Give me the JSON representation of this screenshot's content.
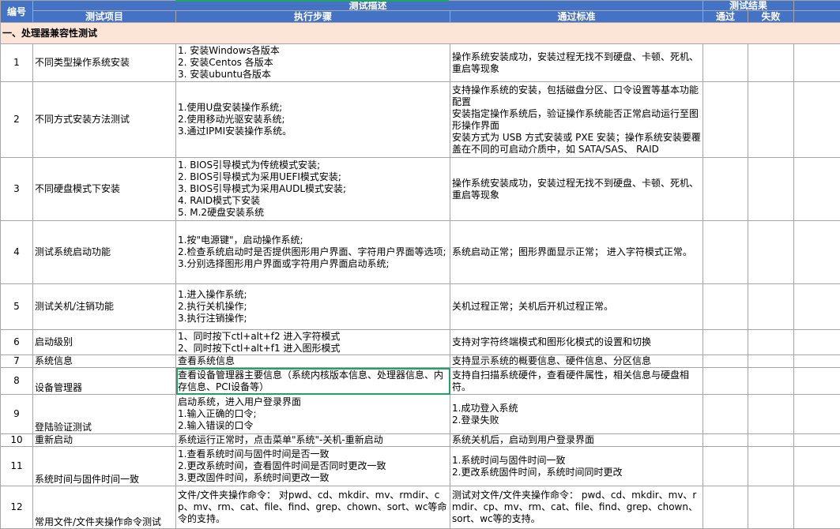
{
  "header": {
    "col_no": "编号",
    "group_desc": "测试描述",
    "group_result": "测试结果",
    "col_item": "测试项目",
    "col_steps": "执行步骤",
    "col_criteria": "通过标准",
    "col_pass": "通过",
    "col_fail": "失败"
  },
  "section": "一、处理器兼容性测试",
  "rows": [
    {
      "no": "1",
      "item": "不同类型操作系统安装",
      "steps": "1. 安装Windows各版本\n2. 安装Centos 各版本\n3. 安装ubuntu各版本",
      "criteria": "操作系统安装成功，安装过程无找不到硬盘、卡顿、死机、重启等现象"
    },
    {
      "no": "2",
      "item": "不同方式安装方法测试",
      "steps": "1.使用U盘安装操作系统;\n2.使用移动光驱安装系统;\n3.通过IPMI安装操作系统。",
      "criteria": "支持操作系统的安装，包括磁盘分区、口令设置等基本功能配置\n安装指定操作系统后，验证操作系统能否正常启动运行至图形操作界面\n安装方式为 USB 方式安装或 PXE 安装；操作系统安装要覆盖在不同的可启动介质中，如 SATA/SAS、 RAID"
    },
    {
      "no": "3",
      "item": "不同硬盘模式下安装",
      "steps": "1. BIOS引导模式为传统模式安装;\n2. BIOS引导模式为采用UEFI模式安装;\n3. BIOS引导模式为采用AUDL模式安装;\n4. RAID模式下安装\n5. M.2硬盘安装系统",
      "criteria": "操作系统安装成功，安装过程无找不到硬盘、卡顿、死机、重启等现象"
    },
    {
      "no": "4",
      "item": "测试系统启动功能",
      "steps": "1.按\"电源键\"，启动操作系统;\n2.检查系统启动时是否提供图形用户界面、字符用户界面等选项;\n3.分别选择图形用户界面或字符用户界面启动系统;",
      "criteria": "系统启动正常；图形界面显示正常； 进入字符模式正常。"
    },
    {
      "no": "5",
      "item": "测试关机/注销功能",
      "steps": "1.进入操作系统;\n2.执行关机操作;\n3.执行注销操作;",
      "criteria": "关机过程正常；关机后开机过程正常。"
    },
    {
      "no": "6",
      "item": "启动级别",
      "steps": "1、同时按下ctl+alt+f2 进入字符模式\n2、同时按下ctl+alt+f1 进入图形模式",
      "criteria": "支持对字符终端模式和图形化模式的设置和切换"
    },
    {
      "no": "7",
      "item": "系统信息",
      "steps": "查看系统信息",
      "criteria": "支持显示系统的概要信息、硬件信息、分区信息"
    },
    {
      "no": "8",
      "item": "设备管理器",
      "steps": "查看设备管理器主要信息（系统内核版本信息、处理器信息、内存信息、PCI设备等）",
      "criteria": "支持自扫描系统硬件，查看硬件属性，相关信息与硬盘相符。"
    },
    {
      "no": "9",
      "item": "登陆验证测试",
      "steps": "启动系统，进入用户登录界面\n1.输入正确的口令;\n2.输入错误的口令",
      "criteria": "1.成功登入系统\n 2.登录失败"
    },
    {
      "no": "10",
      "item": "重新启动",
      "steps": "系统运行正常时，点击菜单\"系统\"-关机-重新启动",
      "criteria": "系统关机后，启动到用户登录界面"
    },
    {
      "no": "11",
      "item": "系统时间与固件时间一致",
      "steps": "1.查看系统时间与固件时间是否一致\n2.更改系统时间，查看固件时间是否同时更改一致\n3.更改固件时间，系统时间更改一致",
      "criteria": "1.系统时间与固件时间一致\n2.更改系统固件时间，系统时间同时更改"
    },
    {
      "no": "12",
      "item": "常用文件/文件夹操作命令测试",
      "steps": "文件/文件夹操作命令： 对pwd、cd、mkdir、mv、rmdir、cp、mv、rm、cat、file、find、grep、chown、sort、wc等命令的支持。",
      "criteria": "测试对文件/文件夹操作命令： pwd、cd、mkdir、mv、rmdir、cp、mv、rm、cat、file、find、grep、chown、sort、wc等的支持。"
    }
  ],
  "colors": {
    "header_bg": "#4472c4",
    "section_bg": "#fce4d6",
    "selection": "#21a366",
    "grid": "#a6a6a6"
  }
}
